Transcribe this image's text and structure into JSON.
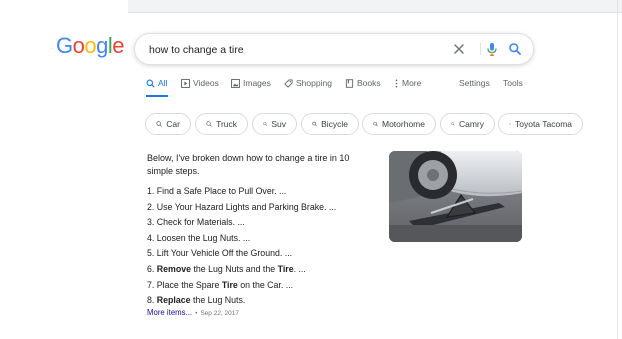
{
  "colors": {
    "google_blue": "#4285F4",
    "google_red": "#EA4335",
    "google_yellow": "#FBBC05",
    "google_green": "#34A853",
    "link": "#1a0dab",
    "tab_active": "#1a73e8"
  },
  "logo": {
    "letters": [
      "G",
      "o",
      "o",
      "g",
      "l",
      "e"
    ],
    "icon": "google-logo"
  },
  "search": {
    "query": "how to change a tire",
    "clear_icon": "close-icon",
    "voice_icon": "microphone-icon",
    "submit_icon": "search-icon"
  },
  "tabs": [
    {
      "label": "All",
      "icon": "search-icon",
      "active": true
    },
    {
      "label": "Videos",
      "icon": "play-icon"
    },
    {
      "label": "Images",
      "icon": "image-icon"
    },
    {
      "label": "Shopping",
      "icon": "tag-icon"
    },
    {
      "label": "Books",
      "icon": "book-icon"
    },
    {
      "label": "More",
      "icon": "more-vertical-icon"
    }
  ],
  "tools": {
    "settings": "Settings",
    "tools": "Tools"
  },
  "chips": [
    "Car",
    "Truck",
    "Suv",
    "Bicycle",
    "Motorhome",
    "Camry",
    "Toyota Tacoma"
  ],
  "snippet": {
    "intro": "Below, I've broken down how to change a tire in 10 simple steps.",
    "steps": [
      {
        "num": "1.",
        "pre": "Find a Safe Place to Pull Over. ...",
        "bold": "",
        "mid": "",
        "bold2": "",
        "post": ""
      },
      {
        "num": "2.",
        "pre": "Use Your Hazard Lights and Parking Brake. ...",
        "bold": "",
        "mid": "",
        "bold2": "",
        "post": ""
      },
      {
        "num": "3.",
        "pre": "Check for Materials. ...",
        "bold": "",
        "mid": "",
        "bold2": "",
        "post": ""
      },
      {
        "num": "4.",
        "pre": "Loosen the Lug Nuts. ...",
        "bold": "",
        "mid": "",
        "bold2": "",
        "post": ""
      },
      {
        "num": "5.",
        "pre": "Lift Your Vehicle Off the Ground. ...",
        "bold": "",
        "mid": "",
        "bold2": "",
        "post": ""
      },
      {
        "num": "6.",
        "pre": "",
        "bold": "Remove",
        "mid": " the Lug Nuts and the ",
        "bold2": "Tire",
        "post": ". ..."
      },
      {
        "num": "7.",
        "pre": "Place the Spare ",
        "bold": "Tire",
        "mid": " on the Car. ...",
        "bold2": "",
        "post": ""
      },
      {
        "num": "8.",
        "pre": "",
        "bold": "Replace",
        "mid": " the Lug Nuts.",
        "bold2": "",
        "post": ""
      }
    ],
    "more_link": "More items...",
    "separator": "•",
    "date": "Sep 22, 2017"
  },
  "image": {
    "subject": "car-jack-under-tire-photo"
  }
}
